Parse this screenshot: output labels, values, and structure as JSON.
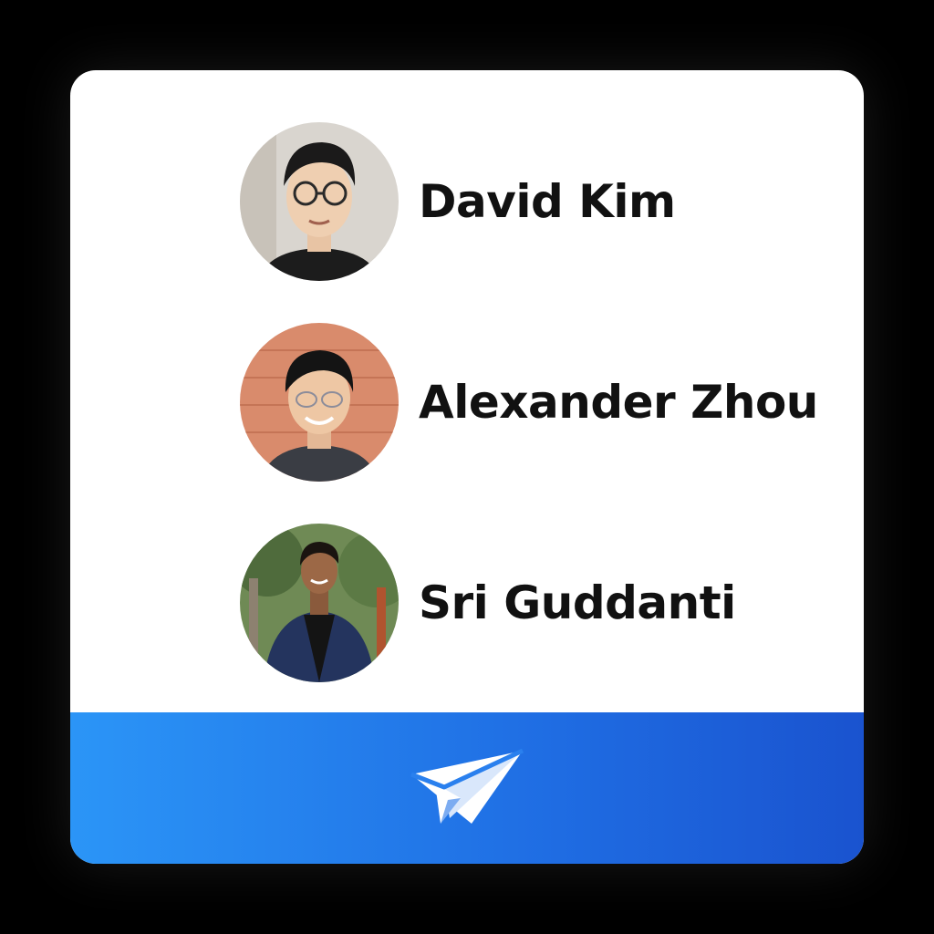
{
  "members": [
    {
      "name": "David Kim"
    },
    {
      "name": "Alexander Zhou"
    },
    {
      "name": "Sri Guddanti"
    }
  ],
  "footer": {
    "icon": "paper-plane-icon",
    "color_start": "#2b95f7",
    "color_end": "#1a53cf"
  }
}
